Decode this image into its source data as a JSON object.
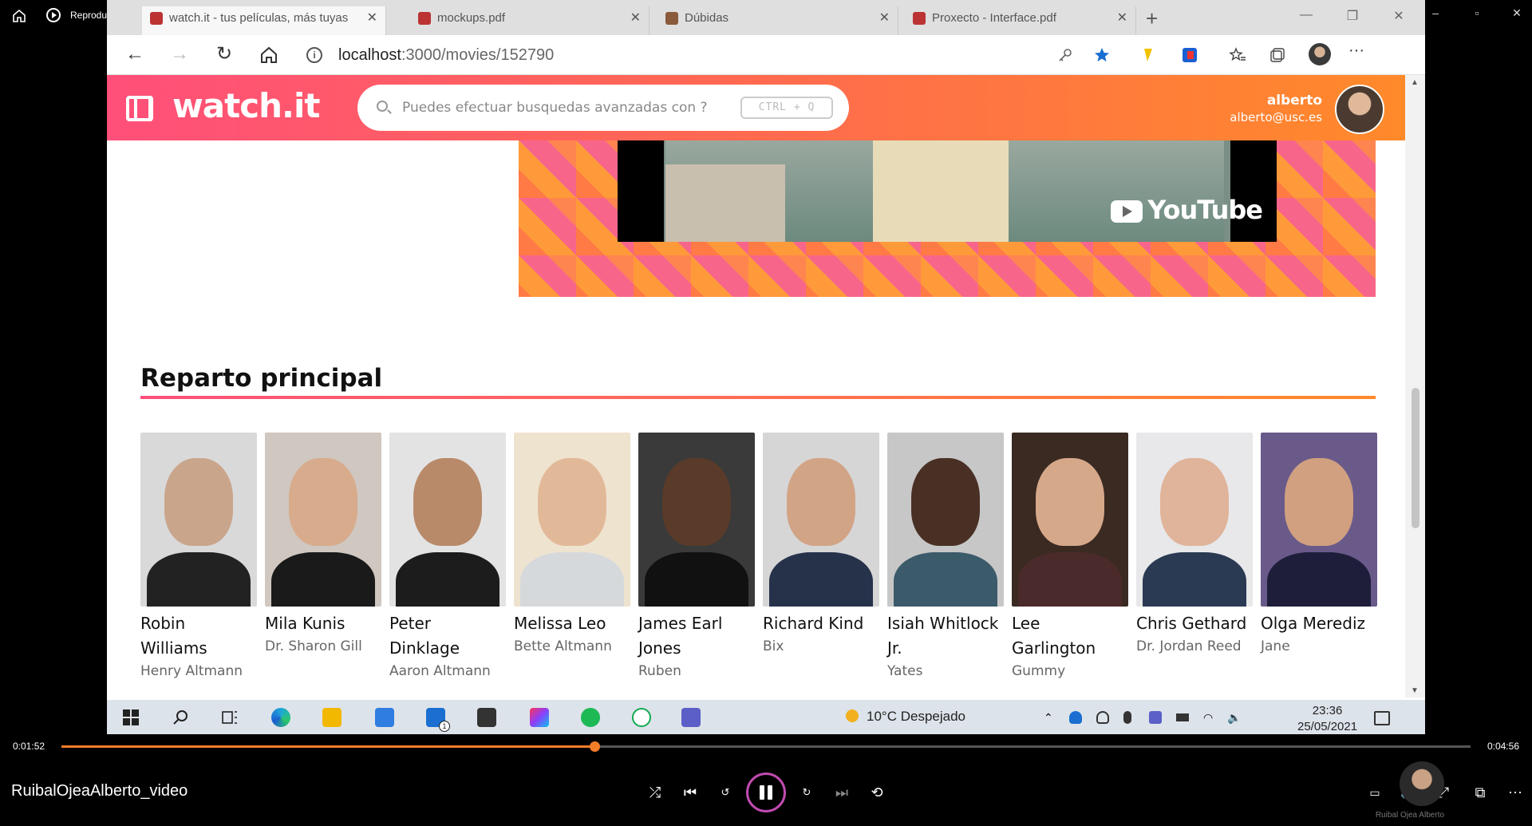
{
  "player": {
    "app_title": "Reproductor multimedia",
    "time_elapsed": "0:01:52",
    "time_total": "0:04:56",
    "progress": 0.378,
    "video_title": "RuibalOjeaAlberto_video",
    "presenter_name": "Ruibal Ojea Alberto",
    "accent_color": "#f47d2a"
  },
  "browser": {
    "tabs": [
      {
        "label": "watch.it - tus películas, más tuyas"
      },
      {
        "label": "mockups.pdf"
      },
      {
        "label": "Dúbidas"
      },
      {
        "label": "Proxecto - Interface.pdf"
      }
    ],
    "url_host": "localhost",
    "url_path": ":3000/movies/152790"
  },
  "site": {
    "logo": "watch.it",
    "search_placeholder": "Puedes efectuar busquedas avanzadas con ?",
    "shortcut": "CTRL + Q",
    "user_name": "alberto",
    "user_email": "alberto@usc.es",
    "brand_gradient": [
      "#ff4f7a",
      "#ff8a2a"
    ]
  },
  "trailer": {
    "provider": "YouTube"
  },
  "cast_section": {
    "title": "Reparto principal",
    "cast": [
      {
        "name": "Robin Williams",
        "role": "Henry Altmann"
      },
      {
        "name": "Mila Kunis",
        "role": "Dr. Sharon Gill"
      },
      {
        "name": "Peter Dinklage",
        "role": "Aaron Altmann"
      },
      {
        "name": "Melissa Leo",
        "role": "Bette Altmann"
      },
      {
        "name": "James Earl Jones",
        "role": "Ruben"
      },
      {
        "name": "Richard Kind",
        "role": "Bix"
      },
      {
        "name": "Isiah Whitlock Jr.",
        "role": "Yates"
      },
      {
        "name": "Lee Garlington",
        "role": "Gummy"
      },
      {
        "name": "Chris Gethard",
        "role": "Dr. Jordan Reed"
      },
      {
        "name": "Olga Merediz",
        "role": "Jane"
      }
    ]
  },
  "taskbar": {
    "weather": "10°C  Despejado",
    "time": "23:36",
    "date": "25/05/2021",
    "mail_badge": "1"
  }
}
